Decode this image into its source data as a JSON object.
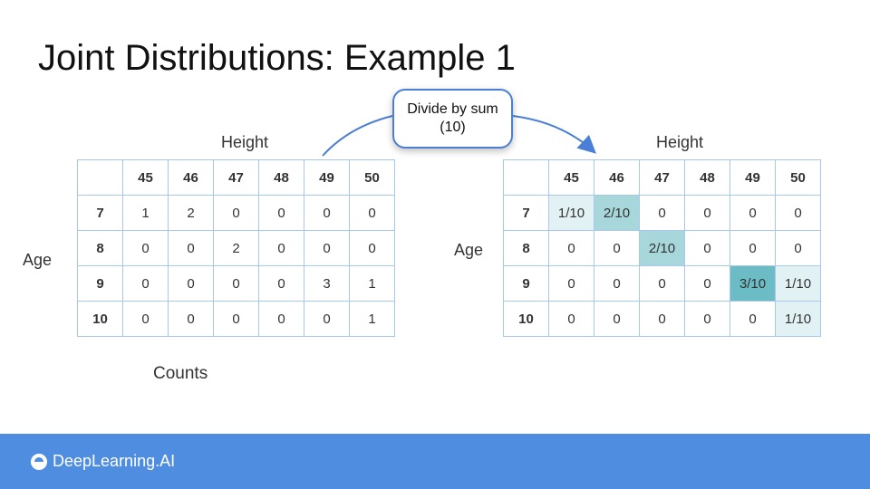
{
  "title": "Joint Distributions: Example 1",
  "left_table": {
    "column_label": "Height",
    "row_label": "Age",
    "caption": "Counts",
    "columns": [
      "45",
      "46",
      "47",
      "48",
      "49",
      "50"
    ],
    "rows": [
      {
        "age": "7",
        "cells": [
          "1",
          "2",
          "0",
          "0",
          "0",
          "0"
        ]
      },
      {
        "age": "8",
        "cells": [
          "0",
          "0",
          "2",
          "0",
          "0",
          "0"
        ]
      },
      {
        "age": "9",
        "cells": [
          "0",
          "0",
          "0",
          "0",
          "3",
          "1"
        ]
      },
      {
        "age": "10",
        "cells": [
          "0",
          "0",
          "0",
          "0",
          "0",
          "1"
        ]
      }
    ]
  },
  "right_table": {
    "column_label": "Height",
    "row_label": "Age",
    "columns": [
      "45",
      "46",
      "47",
      "48",
      "49",
      "50"
    ],
    "rows": [
      {
        "age": "7",
        "cells": [
          "1/10",
          "2/10",
          "0",
          "0",
          "0",
          "0"
        ]
      },
      {
        "age": "8",
        "cells": [
          "0",
          "0",
          "2/10",
          "0",
          "0",
          "0"
        ]
      },
      {
        "age": "9",
        "cells": [
          "0",
          "0",
          "0",
          "0",
          "3/10",
          "1/10"
        ]
      },
      {
        "age": "10",
        "cells": [
          "0",
          "0",
          "0",
          "0",
          "0",
          "1/10"
        ]
      }
    ]
  },
  "callout": {
    "line1": "Divide by sum",
    "line2": "(10)"
  },
  "colors": {
    "shade_10": "#e2f1f4",
    "shade_20": "#a7d6db",
    "shade_30": "#6bbcc4",
    "accent": "#4a7fd6",
    "footer": "#4f8de0"
  },
  "footer": {
    "brand": "DeepLearning.AI",
    "brand_icon": "deeplearning-logo-icon"
  }
}
